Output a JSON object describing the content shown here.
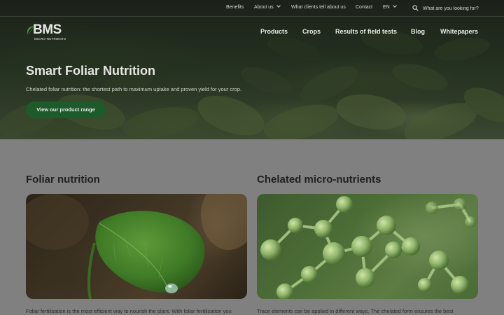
{
  "colors": {
    "page_bg": "#808080",
    "accent_green": "#1d5a2c",
    "hero_text": "#e4e6e2",
    "body_text": "#1f1f1f"
  },
  "topbar": {
    "items": [
      {
        "label": "Benefits"
      },
      {
        "label": "About us",
        "has_dropdown": true
      },
      {
        "label": "What clients tell about us"
      },
      {
        "label": "Contact"
      },
      {
        "label": "EN",
        "has_dropdown": true
      }
    ],
    "search": {
      "placeholder": "What are you looking for?",
      "icon": "search-icon"
    }
  },
  "logo": {
    "word": "BMS",
    "sub": "MICRO-NUTRIENTS"
  },
  "mainnav": {
    "items": [
      {
        "label": "Products"
      },
      {
        "label": "Crops"
      },
      {
        "label": "Results of field tests"
      },
      {
        "label": "Blog"
      },
      {
        "label": "Whitepapers"
      }
    ]
  },
  "hero": {
    "title": "Smart Foliar Nutrition",
    "subtitle": "Chelated foliar nutrition: the shortest path to maximum uptake and proven yield for your crop.",
    "cta_label": "View our product range"
  },
  "sections": [
    {
      "title": "Foliar nutrition",
      "text": "Foliar fertilisation is the most efficient way to nourish the plant. With foliar fertilisation you"
    },
    {
      "title": "Chelated micro-nutrients",
      "text": "Trace elements can be applied in different ways. The chelated form ensures the best"
    }
  ]
}
